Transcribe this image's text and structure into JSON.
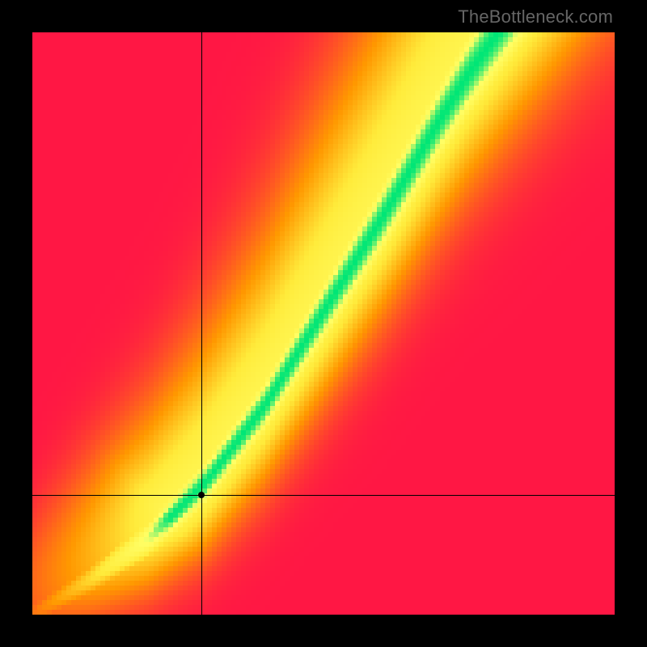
{
  "watermark": "TheBottleneck.com",
  "chart_data": {
    "type": "heatmap",
    "title": "",
    "xlabel": "",
    "ylabel": "",
    "x_range": [
      0,
      1
    ],
    "y_range": [
      0,
      1
    ],
    "marker": {
      "x": 0.29,
      "y": 0.205
    },
    "crosshair": {
      "x": 0.29,
      "y": 0.205
    },
    "green_ridge": [
      {
        "x": 0.0,
        "y": 0.0
      },
      {
        "x": 0.1,
        "y": 0.06
      },
      {
        "x": 0.2,
        "y": 0.13
      },
      {
        "x": 0.3,
        "y": 0.23
      },
      {
        "x": 0.4,
        "y": 0.36
      },
      {
        "x": 0.5,
        "y": 0.52
      },
      {
        "x": 0.6,
        "y": 0.68
      },
      {
        "x": 0.7,
        "y": 0.85
      },
      {
        "x": 0.75,
        "y": 0.93
      },
      {
        "x": 0.8,
        "y": 1.0
      }
    ],
    "colorscale": [
      {
        "t": 0.0,
        "color": "#ff1744"
      },
      {
        "t": 0.35,
        "color": "#ff9800"
      },
      {
        "t": 0.6,
        "color": "#ffeb3b"
      },
      {
        "t": 0.85,
        "color": "#ffff66"
      },
      {
        "t": 1.0,
        "color": "#00e676"
      }
    ],
    "pixel_resolution": 120,
    "description": "Qualitative bottleneck heatmap. Green diagonal band indicates balanced pairing; red/orange regions indicate bottleneck. Black crosshair and dot mark a specific measured configuration in the lower-left quadrant."
  }
}
